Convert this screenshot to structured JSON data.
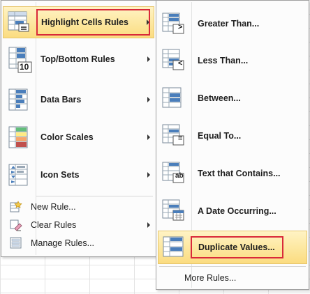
{
  "left_menu": {
    "items": [
      {
        "label": "Highlight Cells Rules",
        "icon": "highlight-cells-rules-icon",
        "has_submenu": true,
        "active": true
      },
      {
        "label": "Top/Bottom Rules",
        "icon": "top-bottom-rules-icon",
        "has_submenu": true
      },
      {
        "label": "Data Bars",
        "icon": "data-bars-icon",
        "has_submenu": true
      },
      {
        "label": "Color Scales",
        "icon": "color-scales-icon",
        "has_submenu": true
      },
      {
        "label": "Icon Sets",
        "icon": "icon-sets-icon",
        "has_submenu": true
      }
    ],
    "small_items": [
      {
        "label": "New Rule...",
        "icon": "new-rule-icon"
      },
      {
        "label": "Clear Rules",
        "icon": "clear-rules-icon",
        "has_submenu": true
      },
      {
        "label": "Manage Rules...",
        "icon": "manage-rules-icon"
      }
    ],
    "icon_overlay_text": "10"
  },
  "right_menu": {
    "items": [
      {
        "label": "Greater Than...",
        "icon": "greater-than-icon"
      },
      {
        "label": "Less Than...",
        "icon": "less-than-icon"
      },
      {
        "label": "Between...",
        "icon": "between-icon"
      },
      {
        "label": "Equal To...",
        "icon": "equal-to-icon"
      },
      {
        "label": "Text that Contains...",
        "icon": "text-contains-icon"
      },
      {
        "label": "A Date Occurring...",
        "icon": "date-occurring-icon"
      },
      {
        "label": "Duplicate Values...",
        "icon": "duplicate-values-icon",
        "active": true
      }
    ],
    "more_rules": "More Rules...",
    "glyphs": {
      "greater": ">",
      "less": "<",
      "equal": "=",
      "text": "ab"
    }
  },
  "colors": {
    "highlight_top": "#fff3c4",
    "highlight_bottom": "#fbdc80",
    "callout_red": "#d9293a",
    "icon_blue": "#4a7ebb",
    "icon_red": "#c0504d"
  }
}
